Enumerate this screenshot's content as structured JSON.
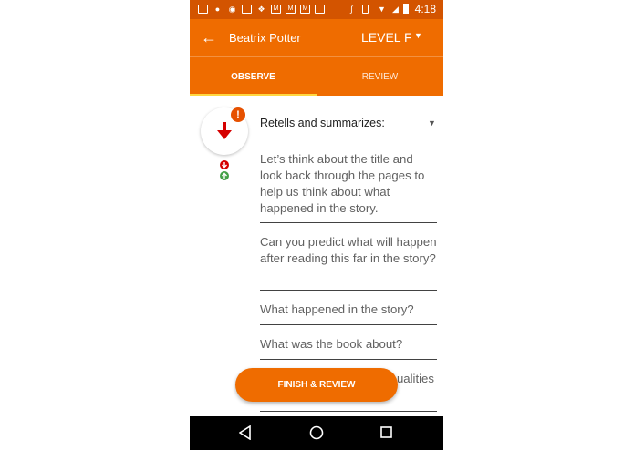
{
  "status_bar": {
    "time": "4:18",
    "left_icons": [
      "messaging-icon",
      "hangouts-icon",
      "chat-icon",
      "image-icon",
      "dropbox-icon",
      "gmail-icon",
      "gmail-icon",
      "gmail-icon",
      "image-icon"
    ],
    "right_icons": [
      "bluetooth-icon",
      "vibrate-icon",
      "wifi-icon",
      "signal-icon",
      "battery-icon"
    ]
  },
  "app_bar": {
    "title": "Beatrix Potter",
    "level": "LEVEL F"
  },
  "tabs": [
    {
      "label": "OBSERVE",
      "active": true
    },
    {
      "label": "REVIEW",
      "active": false
    }
  ],
  "indicator": {
    "badge": "!",
    "colors": {
      "accent": "#ef6c00",
      "down": "#d50000",
      "up": "#43a047"
    }
  },
  "section": {
    "title": "Retells and summarizes:",
    "prompts": [
      "Let’s think about the title and look back through the pages to help us think about what happened in the story.",
      "Can you predict what will happen after reading this far in the story?",
      "What happened in the story?",
      "What was the book about?",
      "ualities"
    ]
  },
  "finish_button": "FINISH & REVIEW"
}
